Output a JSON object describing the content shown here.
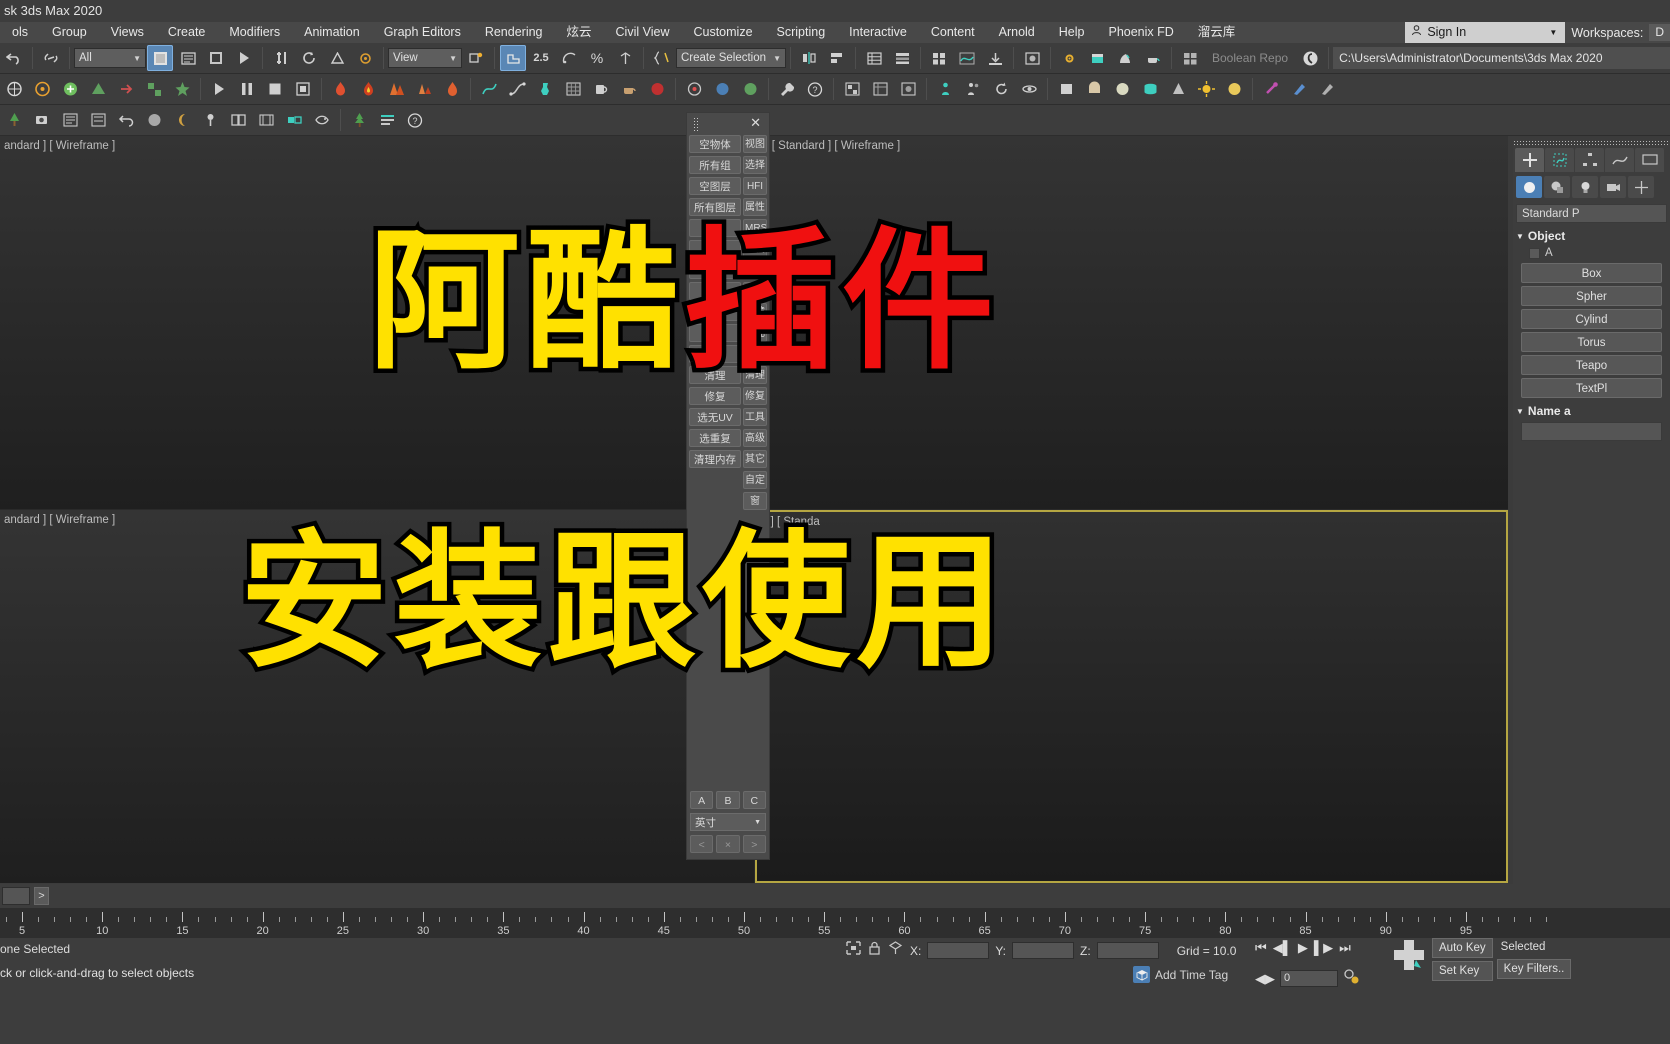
{
  "window": {
    "title": "sk 3ds Max 2020"
  },
  "menubar": {
    "items": [
      "ols",
      "Group",
      "Views",
      "Create",
      "Modifiers",
      "Animation",
      "Graph Editors",
      "Rendering",
      "炫云",
      "Civil View",
      "Customize",
      "Scripting",
      "Interactive",
      "Content",
      "Arnold",
      "Help",
      "Phoenix FD",
      "溜云库"
    ],
    "sign_in": "Sign In",
    "workspaces_label": "Workspaces:",
    "workspaces_value": "D"
  },
  "toolbar": {
    "filter_value": "All",
    "view_value": "View",
    "selection_set_value": "Create Selection Set",
    "boolean_repo": "Boolean Repo",
    "project_path": "C:\\Users\\Administrator\\Documents\\3ds Max 2020"
  },
  "viewports": [
    {
      "label": "andard ] [ Wireframe ]"
    },
    {
      "label": ": ] [ Standard ] [ Wireframe ]"
    },
    {
      "label": "andard ] [ Wireframe ]"
    },
    {
      "label": "e ] [ Standa"
    }
  ],
  "overlay": {
    "line1_yellow": "阿酷",
    "line1_red": "插件",
    "line2": "安装跟使用"
  },
  "plugin_panel": {
    "close": "✕",
    "left_buttons": [
      "空物体",
      "所有组",
      "空图层",
      "所有图层",
      "图形",
      "样条",
      "组合",
      "装饰",
      "场景",
      "图形",
      "材质",
      "清理",
      "修复",
      "选无UV",
      "选重复",
      "清理内存"
    ],
    "right_buttons": [
      "视图",
      "选择",
      "HFI",
      "属性",
      "MRS",
      "堆栈",
      "组",
      "装载",
      "场障",
      "图元",
      "材质",
      "清理",
      "修复",
      "工具",
      "高级",
      "其它",
      "自定",
      "窗"
    ],
    "abc": [
      "A",
      "B",
      "C"
    ],
    "unit_value": "英寸",
    "nav": [
      "<",
      "×",
      ">"
    ]
  },
  "command_panel": {
    "dropdown": "Standard P",
    "rollout_object_type": "Object",
    "autogrid_label": "A",
    "object_buttons": [
      "Box",
      "Spher",
      "Cylind",
      "Torus",
      "Teapo",
      "TextPl"
    ],
    "rollout_name": "Name a"
  },
  "timeline": {
    "ticks": [
      5,
      10,
      15,
      20,
      25,
      30,
      35,
      40,
      45,
      50,
      55,
      60,
      65,
      70,
      75,
      80,
      85,
      90,
      95
    ],
    "next_label": ">"
  },
  "statusbar": {
    "selection": "one Selected",
    "prompt": "ck or click-and-drag to select objects",
    "x_label": "X:",
    "y_label": "Y:",
    "z_label": "Z:",
    "x_value": "",
    "y_value": "",
    "z_value": "",
    "grid": "Grid = 10.0",
    "add_time_tag": "Add Time Tag",
    "frame_value": "0",
    "auto_key": "Auto Key",
    "set_key": "Set Key",
    "selected": "Selected",
    "key_filters": "Key Filters.."
  },
  "colors": {
    "accent_blue": "#4b7fb5",
    "overlay_yellow": "#ffe100",
    "overlay_red": "#f01010",
    "active_viewport_border": "#b5a642"
  }
}
